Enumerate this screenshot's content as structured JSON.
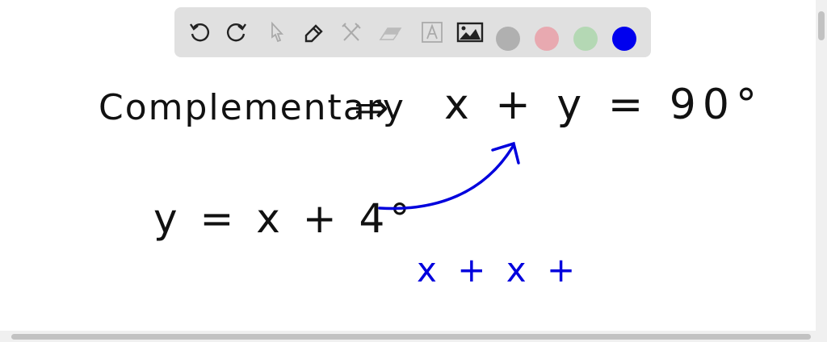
{
  "toolbar": {
    "tools": [
      "undo-icon",
      "redo-icon",
      "select-icon",
      "pen-icon",
      "tools-icon",
      "eraser-icon",
      "text-icon",
      "image-icon"
    ],
    "colors": [
      "#b0b0b0",
      "#e8a9b0",
      "#b4d8b4",
      "#0000ee"
    ]
  },
  "canvas": {
    "line1_left": "Complementary",
    "line1_arrow": "⇒",
    "line1_right": "x + y = 90°",
    "line2": "y = x + 4°",
    "line3": "x + x +",
    "ink_black": "#111111",
    "ink_blue": "#0000dd"
  }
}
